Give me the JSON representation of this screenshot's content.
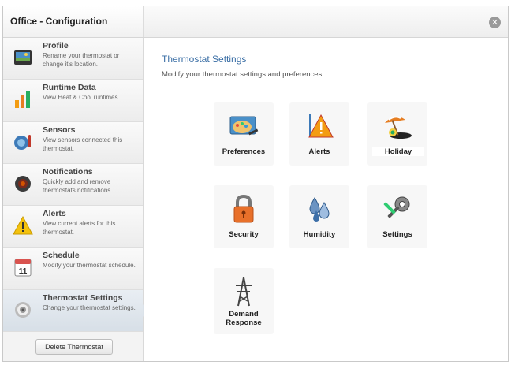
{
  "window": {
    "title": "Office - Configuration",
    "close_icon": "close-circle-icon"
  },
  "sidebar": {
    "items": [
      {
        "id": "profile",
        "title": "Profile",
        "desc": "Rename your thermostat or change it's location.",
        "icon": "profile-picture-icon"
      },
      {
        "id": "runtime",
        "title": "Runtime Data",
        "desc": "View Heat & Cool runtimes.",
        "icon": "bar-chart-icon"
      },
      {
        "id": "sensors",
        "title": "Sensors",
        "desc": "View sensors connected this thermostat.",
        "icon": "sensor-icon"
      },
      {
        "id": "notifications",
        "title": "Notifications",
        "desc": "Quickly add and remove thermostats notifications",
        "icon": "notification-icon"
      },
      {
        "id": "alerts",
        "title": "Alerts",
        "desc": "View current alerts for this thermostat.",
        "icon": "warning-icon"
      },
      {
        "id": "schedule",
        "title": "Schedule",
        "desc": "Modify your thermostat schedule.",
        "icon": "calendar-icon",
        "calendar_day": "11"
      },
      {
        "id": "thermostat-settings",
        "title": "Thermostat Settings",
        "desc": "Change your thermostat settings.",
        "icon": "target-icon",
        "active": true
      }
    ],
    "delete_label": "Delete Thermostat"
  },
  "main": {
    "title": "Thermostat Settings",
    "subtitle": "Modify your thermostat settings and preferences.",
    "tiles": [
      {
        "id": "preferences",
        "label": "Preferences",
        "icon": "palette-icon"
      },
      {
        "id": "alerts",
        "label": "Alerts",
        "icon": "alert-triangle-icon"
      },
      {
        "id": "holiday",
        "label": "Holiday",
        "icon": "beach-umbrella-icon"
      },
      {
        "id": "security",
        "label": "Security",
        "icon": "padlock-icon"
      },
      {
        "id": "humidity",
        "label": "Humidity",
        "icon": "water-drops-icon"
      },
      {
        "id": "settings",
        "label": "Settings",
        "icon": "tools-icon"
      },
      {
        "id": "demand-response",
        "label": "Demand\nResponse",
        "icon": "power-tower-icon"
      }
    ]
  },
  "colors": {
    "accent_blue": "#3a6ea5",
    "active_item": "#d7dfe7",
    "alert_orange": "#f39c12"
  }
}
